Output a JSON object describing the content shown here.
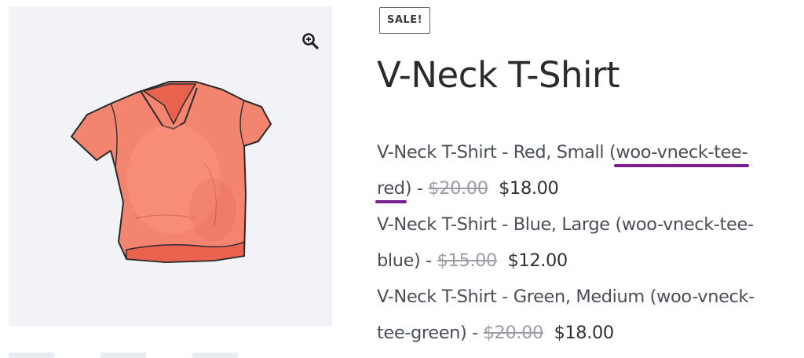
{
  "badge": {
    "label": "SALE!"
  },
  "product": {
    "title": "V-Neck T-Shirt"
  },
  "icons": {
    "zoom": "magnify-plus-icon",
    "zoom_color": "#222222"
  },
  "image": {
    "subject": "red-v-neck-tshirt",
    "shirt_color": "#f2806c"
  },
  "variants": [
    {
      "prefix": "V-Neck T-Shirt - Red, Small (",
      "sku_line1": "woo-vneck-tee-",
      "sku_line2": "red",
      "suffix": ") - ",
      "old_price": "$20.00",
      "new_price": "$18.00"
    },
    {
      "line1": "V-Neck T-Shirt - Blue, Large (woo-vneck-tee-",
      "line2": "blue) - ",
      "old_price": "$15.00",
      "new_price": "$12.00"
    },
    {
      "line1": "V-Neck T-Shirt - Green, Medium (woo-vneck-",
      "line2": "tee-green) - ",
      "old_price": "$20.00",
      "new_price": "$18.00"
    }
  ],
  "colors": {
    "highlight_underline": "#7a1f8f",
    "price_old": "#9a9ea5",
    "text": "#4a4f57"
  }
}
